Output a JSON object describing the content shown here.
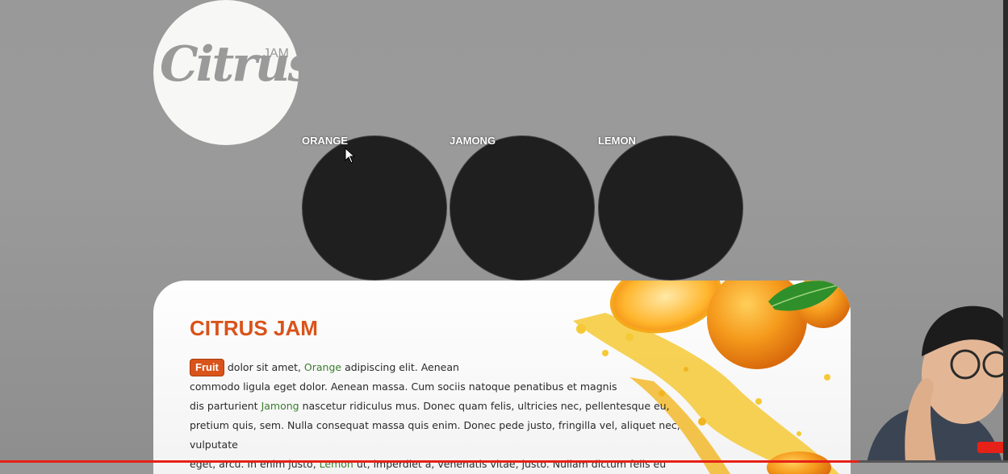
{
  "logo": {
    "word": "Citrus",
    "sub": "JAM"
  },
  "nav": [
    {
      "label": "ORANGE"
    },
    {
      "label": "JAMONG"
    },
    {
      "label": "LEMON"
    }
  ],
  "content": {
    "title": "CITRUS JAM",
    "badge": "Fruit",
    "p1": " dolor sit amet, ",
    "hl1": "Orange",
    "p2": " adipiscing elit. Aenean",
    "p3": "commodo ligula eget dolor. Aenean massa. Cum sociis natoque penatibus et magnis",
    "p4": "dis parturient ",
    "hl2": "Jamong",
    "p5": " nascetur ridiculus mus. Donec quam felis, ultricies nec, pellentesque eu,",
    "p6": "pretium quis, sem. Nulla consequat massa quis enim. Donec pede justo, fringilla vel, aliquet nec, vulputate",
    "p7": "eget, arcu. In enim justo, ",
    "hl3": "Lemon",
    "p8": " ut, imperdiet a, venenatis vitae, justo. Nullam dictum felis eu pede"
  },
  "video": {
    "progress_percent": 85.2
  },
  "colors": {
    "accent": "#d9531a",
    "highlight": "#3a7d2e",
    "progress": "#e62117"
  }
}
